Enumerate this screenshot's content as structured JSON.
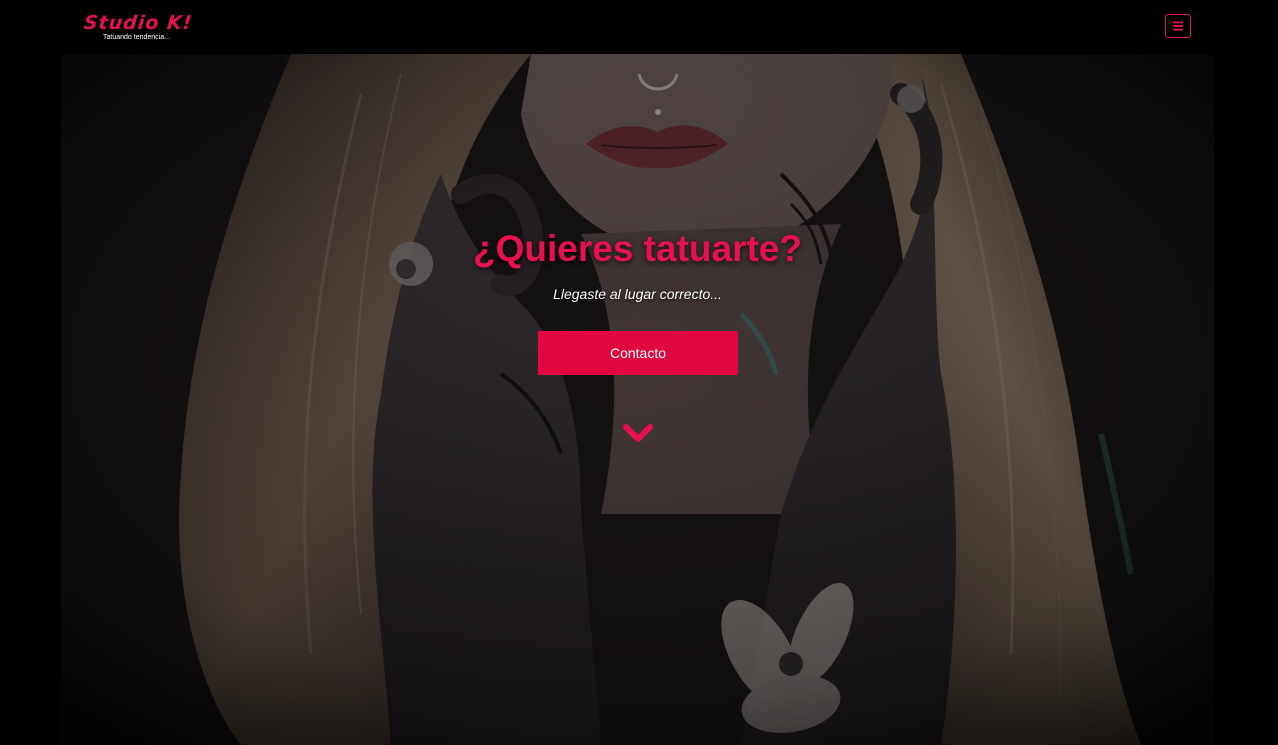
{
  "navbar": {
    "brand_title": "Studio K!",
    "brand_tagline": "Tatuando tendencia...",
    "menu_icon": "hamburger-menu-icon"
  },
  "hero": {
    "title": "¿Quieres tatuarte?",
    "subtitle": "Llegaste al lugar correcto...",
    "contact_button": "Contacto",
    "scroll_icon": "chevron-down-icon",
    "background": "photo of tattooed woman posing with hands on face"
  },
  "colors": {
    "accent": "#e8114f",
    "button": "#e0063f",
    "navbar_bg": "#000000",
    "text_light": "#ffffff"
  }
}
